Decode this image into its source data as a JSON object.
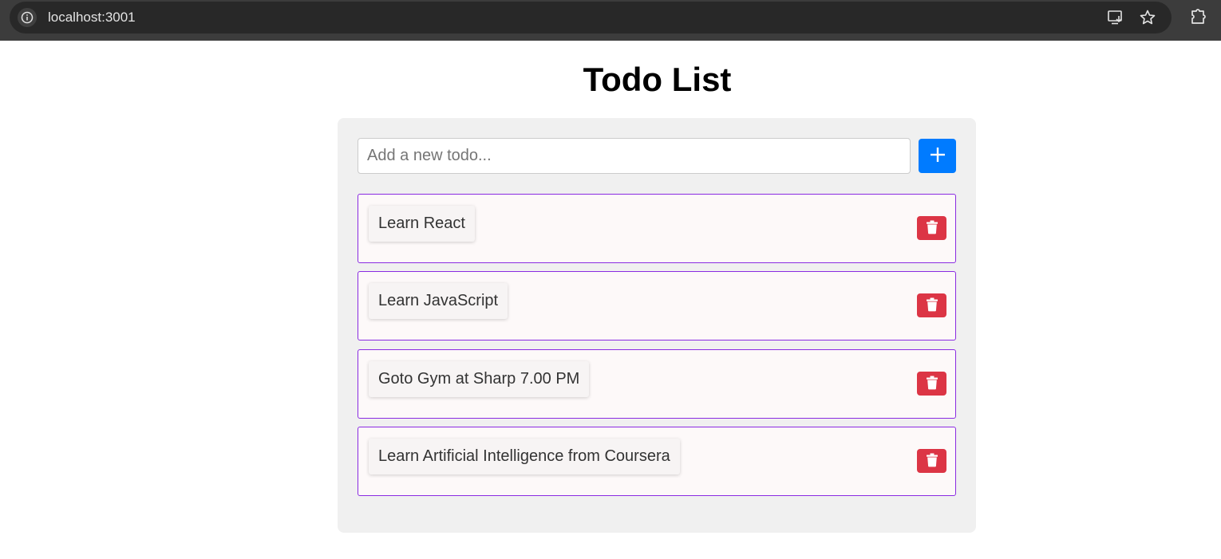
{
  "browser": {
    "url": "localhost:3001",
    "icons": [
      "site-info-icon",
      "install-app-icon",
      "bookmark-star-icon",
      "extensions-icon"
    ]
  },
  "page": {
    "title": "Todo List"
  },
  "new_todo": {
    "placeholder": "Add a new todo...",
    "value": "",
    "add_icon": "plus-icon"
  },
  "todos": [
    {
      "text": "Learn React",
      "delete_icon": "trash-icon"
    },
    {
      "text": "Learn JavaScript",
      "delete_icon": "trash-icon"
    },
    {
      "text": "Goto Gym at Sharp 7.00 PM",
      "delete_icon": "trash-icon"
    },
    {
      "text": "Learn Artificial Intelligence from Coursera",
      "delete_icon": "trash-icon"
    }
  ],
  "colors": {
    "add_button": "#007bff",
    "delete_button": "#dc3545",
    "item_border": "#8a2be2",
    "card_background": "#f0f0f0"
  }
}
